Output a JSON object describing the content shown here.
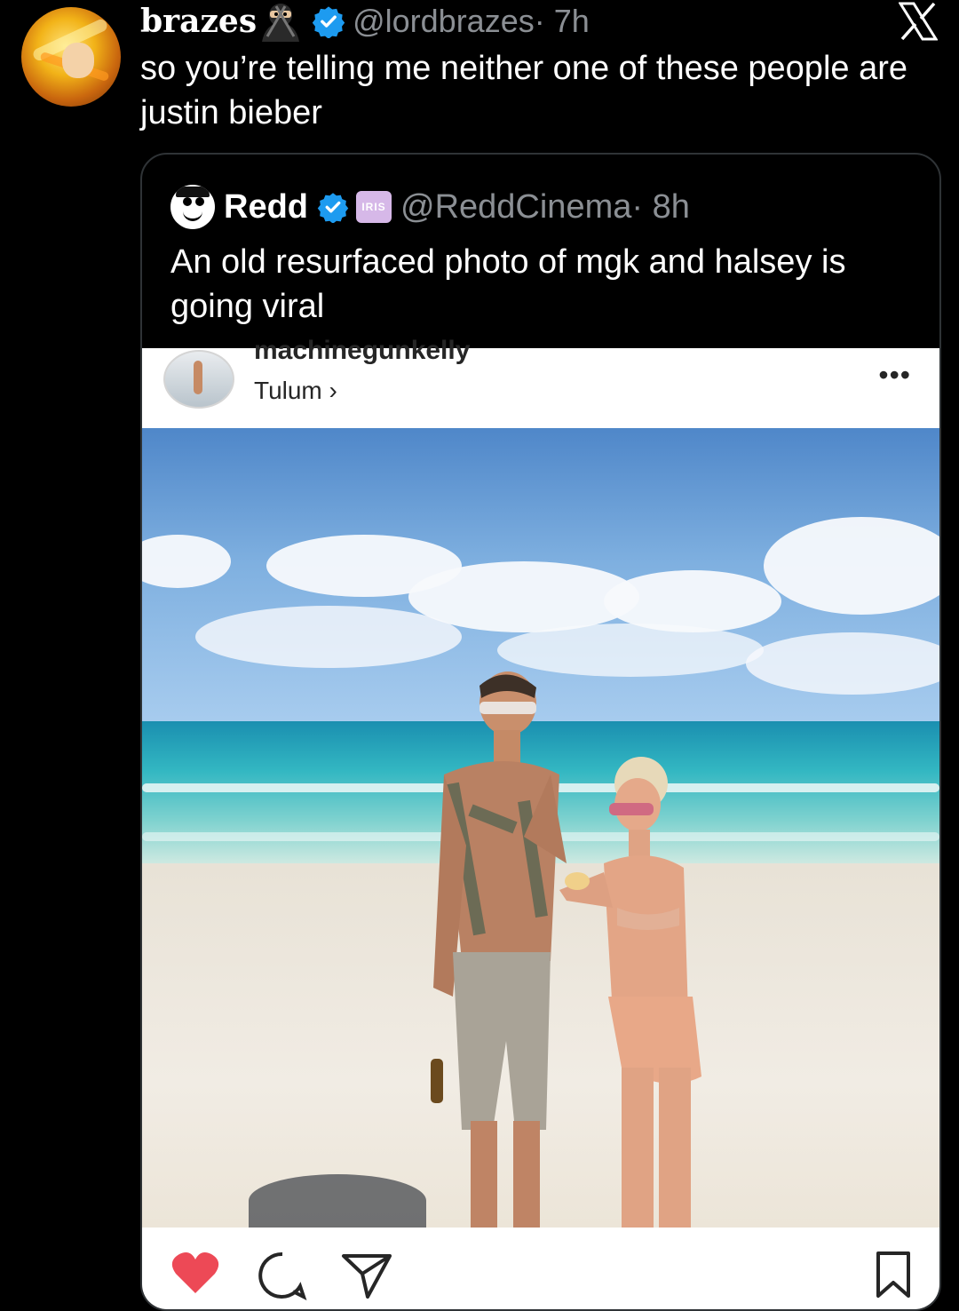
{
  "tweet": {
    "display_name": "brazes",
    "handle": "@lordbrazes",
    "time": " · 7h",
    "text": "so you’re telling me neither one of these people are justin bieber"
  },
  "quoted_tweet": {
    "display_name": "Redd",
    "badge": "IRIS",
    "handle": "@ReddCinema",
    "time": " · 8h",
    "text": "An old resurfaced photo of mgk and halsey is going viral"
  },
  "instagram_post": {
    "username": "machinegunkelly",
    "location": "Tulum",
    "location_chevron": "›",
    "more": "•••"
  },
  "colors": {
    "background": "#000000",
    "verified": "#1d9bf0",
    "heart": "#ed4956",
    "muted": "#8b8f94"
  },
  "icons": [
    "ninja-emoji-icon",
    "verified-icon",
    "x-logo-icon",
    "iris-badge-icon",
    "heart-icon",
    "comment-icon",
    "share-icon",
    "bookmark-icon"
  ]
}
